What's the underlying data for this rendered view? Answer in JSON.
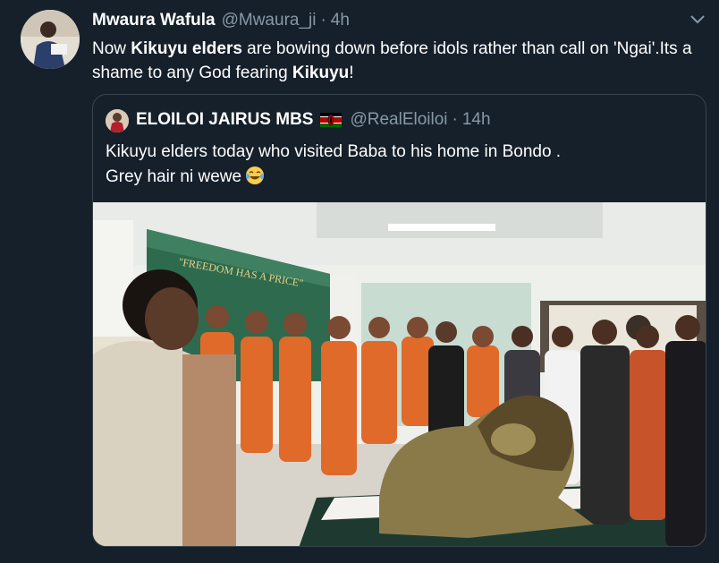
{
  "tweet": {
    "author_name": "Mwaura Wafula",
    "author_handle": "@Mwaura_ji",
    "separator": "·",
    "time": "4h",
    "text": {
      "part1": "Now ",
      "bold1": "Kikuyu elders",
      "part2": " are bowing down before idols rather than call on 'Ngai'.Its a shame to any God fearing ",
      "bold2": "Kikuyu",
      "part3": "!"
    }
  },
  "quoted": {
    "author_name": "ELOILOI JAIRUS MBS",
    "author_handle": "@RealEloiloi",
    "separator": "·",
    "time": "14h",
    "line1": "Kikuyu elders today who visited Baba to his home in Bondo .",
    "line2": "Grey hair ni wewe",
    "photo_sign": "\"FREEDOM HAS A PRICE\""
  },
  "icons": {
    "menu": "chevron-down-icon",
    "flag": "kenya-flag-icon",
    "emoji": "tears-of-joy-emoji-icon"
  },
  "colors": {
    "background": "#15202b",
    "secondary_text": "#8899a6",
    "border": "#38444d"
  }
}
